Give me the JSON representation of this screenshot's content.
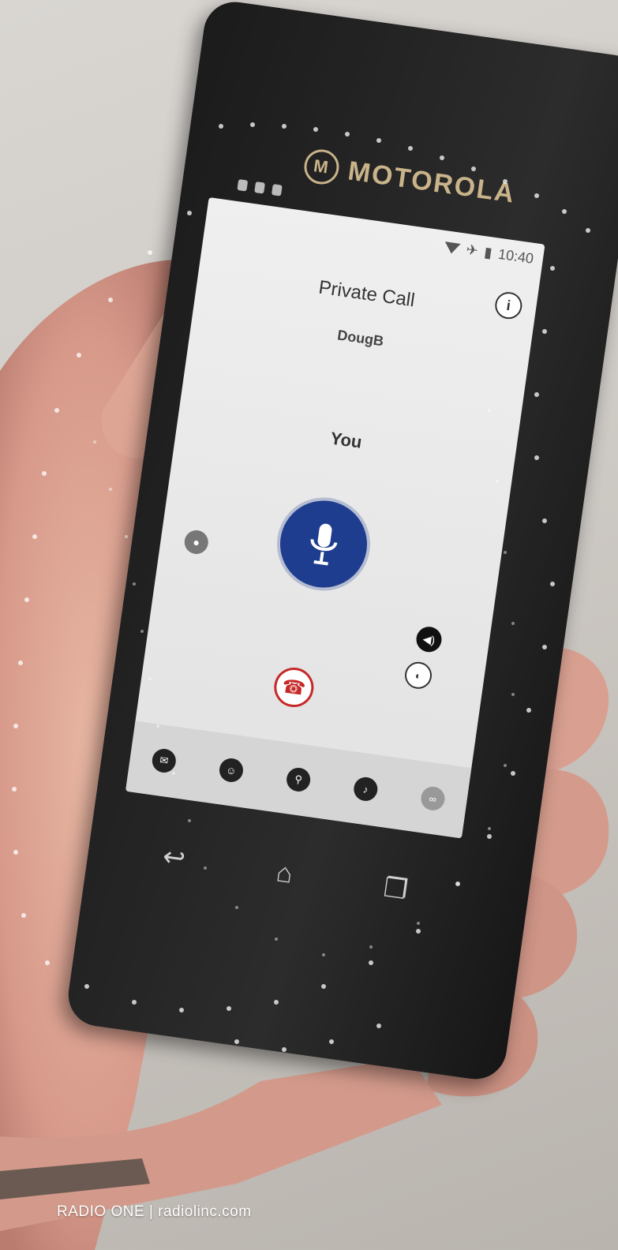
{
  "brand": {
    "name": "MOTOROLA"
  },
  "status_bar": {
    "time": "10:40"
  },
  "call": {
    "title": "Private Call",
    "contact": "DougB",
    "speaker": "You"
  },
  "icons": {
    "info": "info-icon",
    "mic": "microphone-icon",
    "end_call": "phone-hangup-icon",
    "volume": "volume-icon",
    "speaker": "speaker-icon",
    "emergency": "emergency-icon"
  },
  "tabs": [
    {
      "name": "messages-icon"
    },
    {
      "name": "contacts-icon"
    },
    {
      "name": "location-icon"
    },
    {
      "name": "talkgroup-icon"
    },
    {
      "name": "more-icon"
    }
  ],
  "navigation": [
    "back-icon",
    "home-icon",
    "recent-apps-icon"
  ],
  "colors": {
    "mic_button": "#1f3d8f",
    "end_call": "#c62828"
  },
  "footer": {
    "text": "RADIO ONE  |  radiolinc.com"
  }
}
